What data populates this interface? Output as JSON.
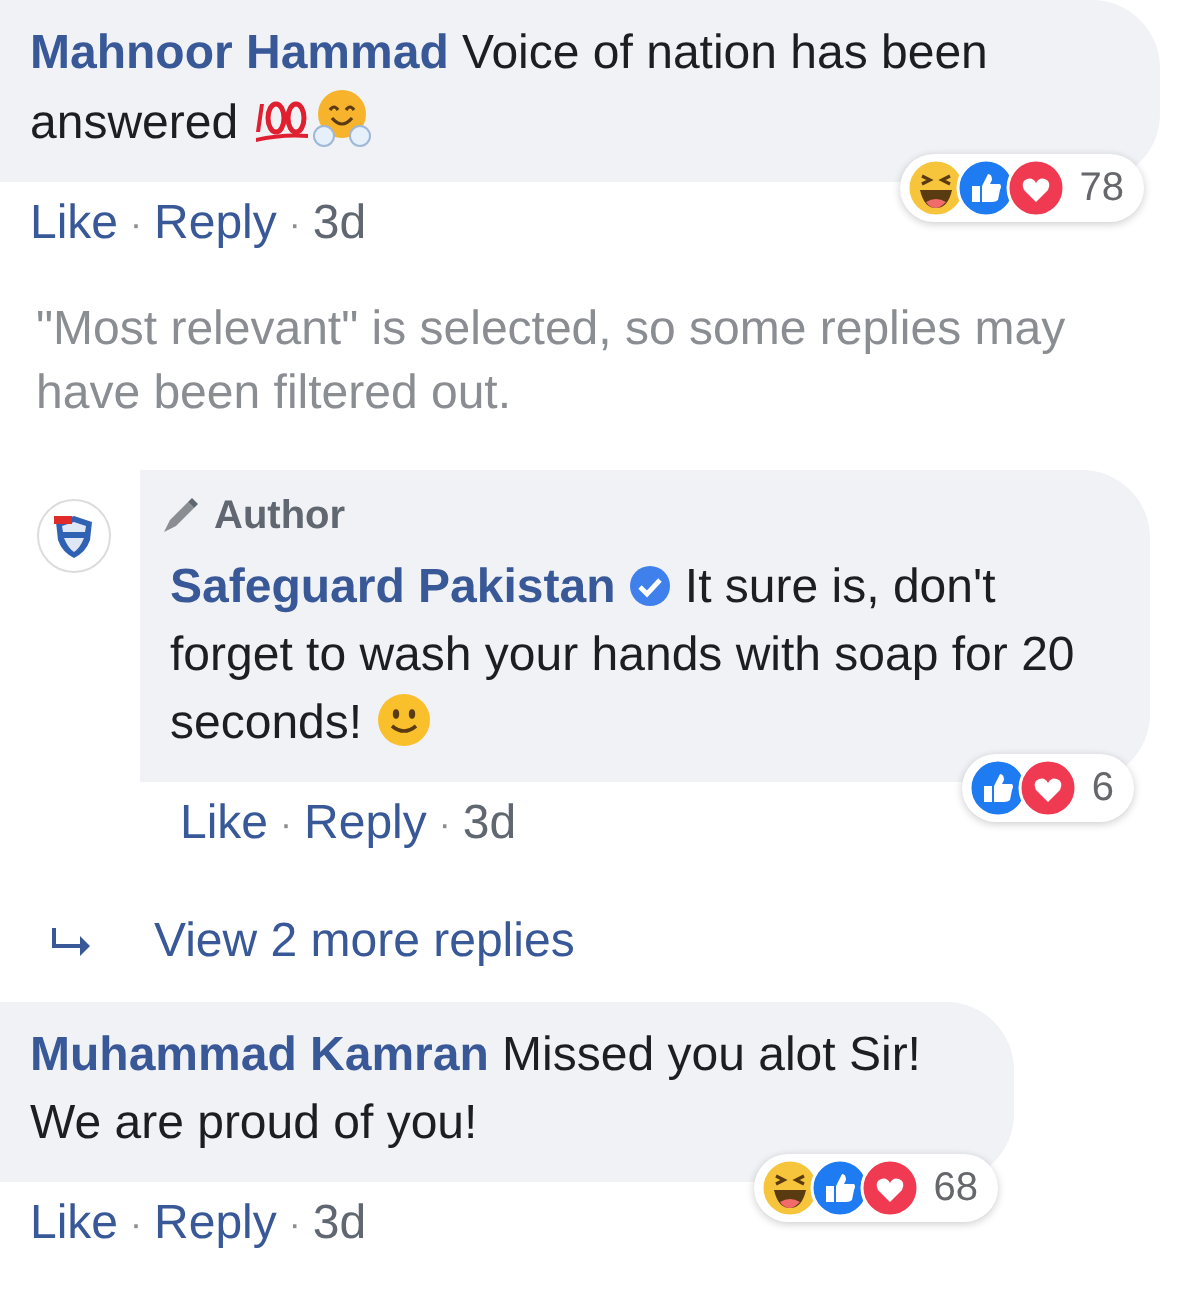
{
  "comments": [
    {
      "kind": "comment",
      "author": "Mahnoor Hammad",
      "text": "Voice of nation has been answered",
      "trailing_icons": [
        {
          "kind": "hundred"
        },
        {
          "kind": "hug"
        }
      ],
      "reactions": [
        {
          "kind": "haha"
        },
        {
          "kind": "like"
        },
        {
          "kind": "love"
        }
      ],
      "reaction_count": "78",
      "actions": [
        "Like",
        "Reply"
      ],
      "separator": "·",
      "time": "3d"
    },
    {
      "kind": "notice",
      "text": "\"Most relevant\" is selected, so some replies may have been filtered out."
    },
    {
      "kind": "reply",
      "badge": "Author",
      "author": "Safeguard Pakistan",
      "verified": true,
      "text": "It sure is, don't forget to wash your hands with soap for 20 seconds!",
      "trailing_icons": [
        {
          "kind": "smile"
        }
      ],
      "reactions": [
        {
          "kind": "like"
        },
        {
          "kind": "love"
        }
      ],
      "reaction_count": "6",
      "actions": [
        "Like",
        "Reply"
      ],
      "separator": "·",
      "time": "3d"
    },
    {
      "kind": "more",
      "text": "View 2 more replies"
    },
    {
      "kind": "comment",
      "author": "Muhammad Kamran",
      "text": "Missed you alot Sir! We are proud of you!",
      "reactions": [
        {
          "kind": "haha"
        },
        {
          "kind": "like"
        },
        {
          "kind": "love"
        }
      ],
      "reaction_count": "68",
      "actions": [
        "Like",
        "Reply"
      ],
      "separator": "·",
      "time": "3d"
    }
  ]
}
